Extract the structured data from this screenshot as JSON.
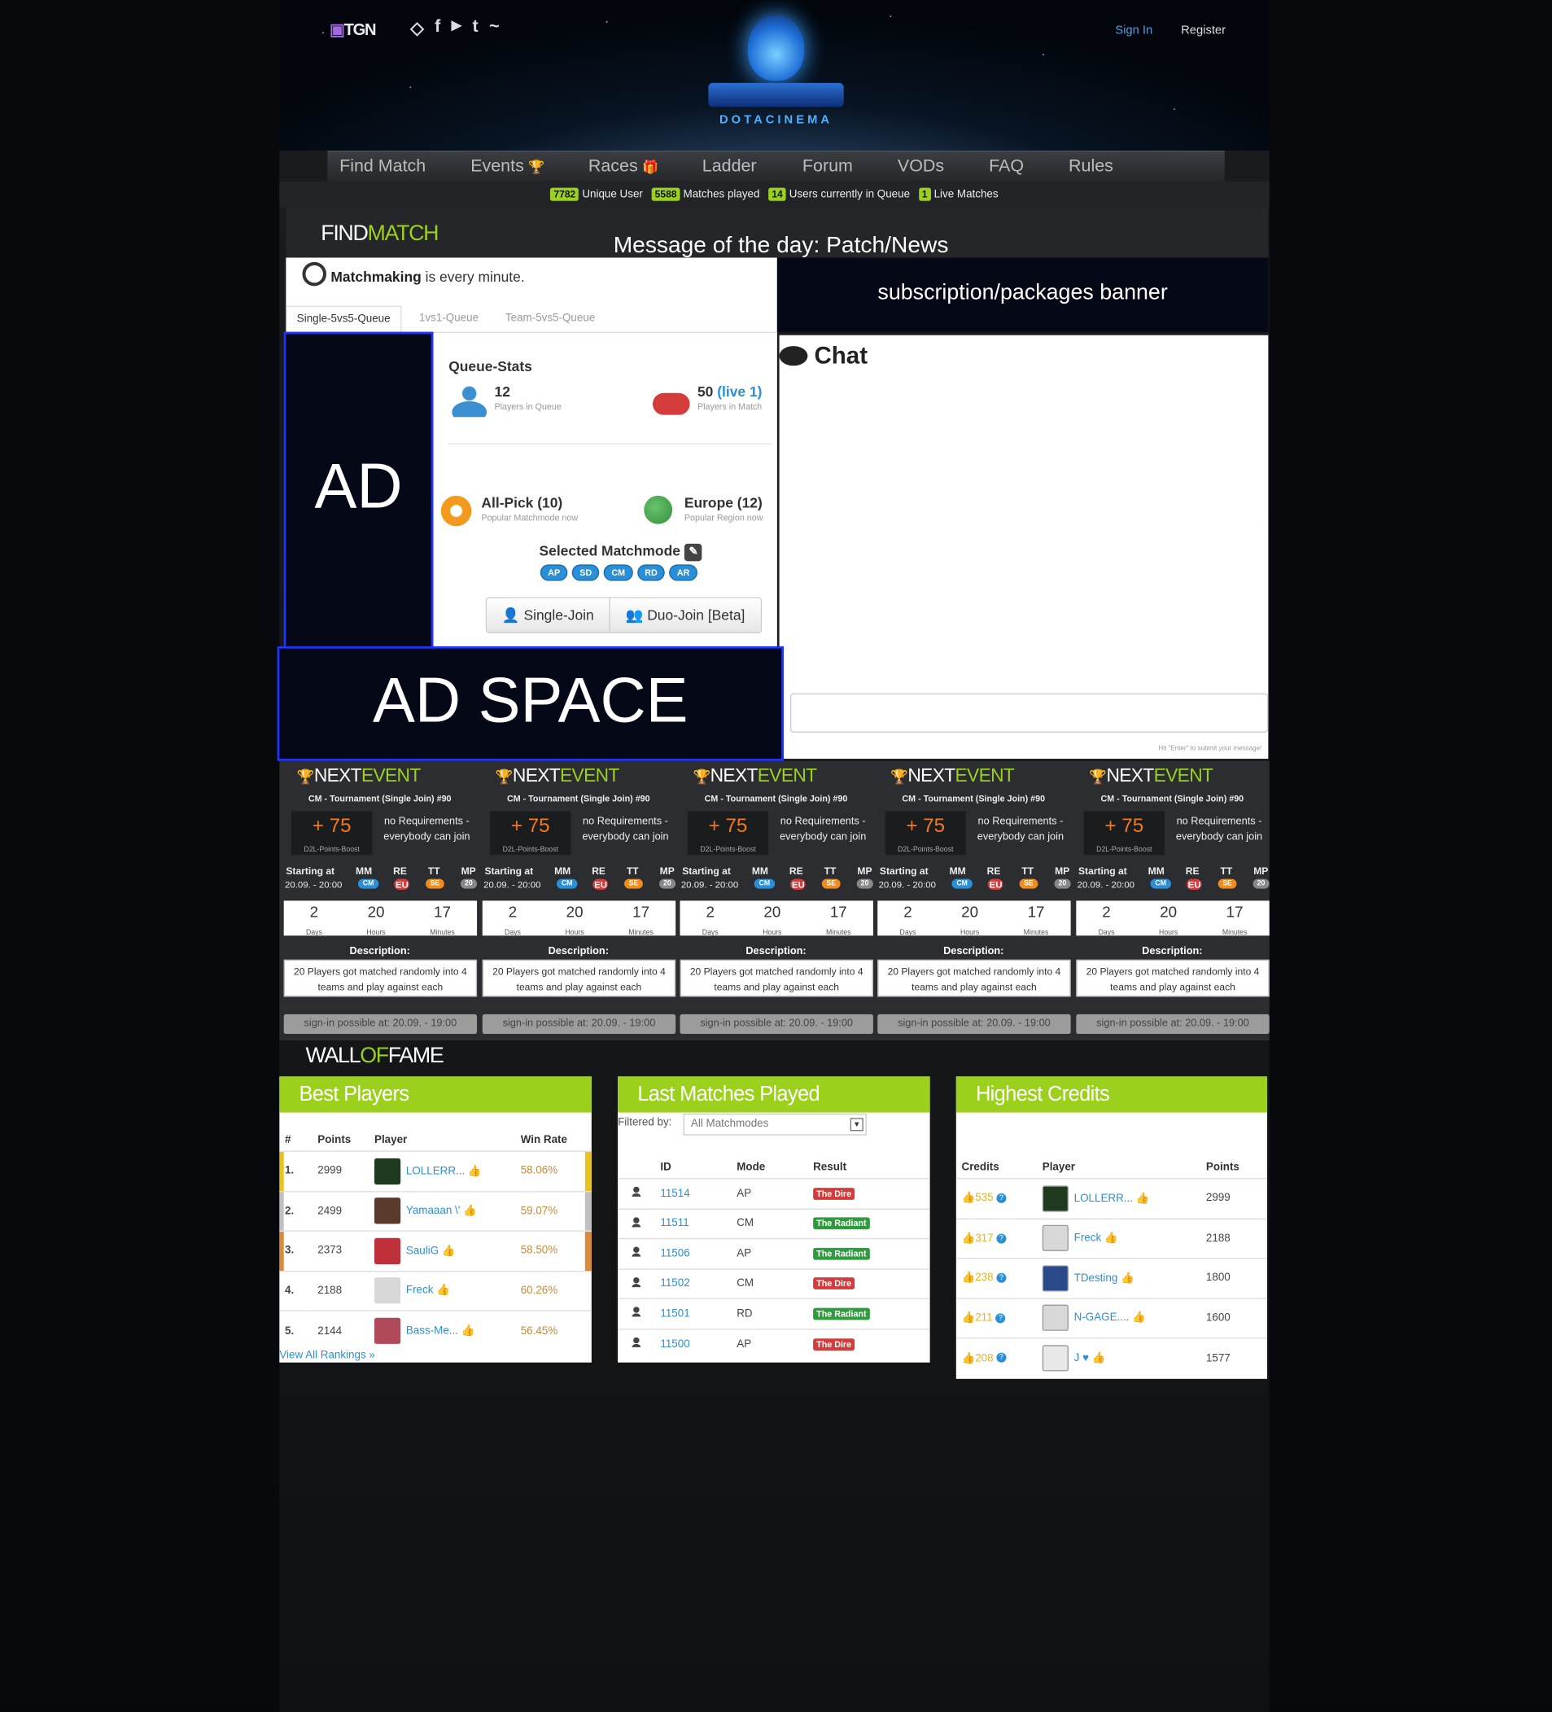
{
  "header": {
    "brand": "TGN",
    "social": [
      "steam-icon",
      "facebook-icon",
      "youtube-icon",
      "twitter-icon",
      "twitch-icon"
    ],
    "logo_text": "DOTACINEMA",
    "sign_in": "Sign In",
    "register": "Register"
  },
  "nav": [
    "Find Match",
    "Events",
    "Races",
    "Ladder",
    "Forum",
    "VODs",
    "FAQ",
    "Rules"
  ],
  "stats": [
    {
      "value": "7782",
      "label": "Unique User"
    },
    {
      "value": "5588",
      "label": "Matches played"
    },
    {
      "value": "14",
      "label": "Users currently in Queue"
    },
    {
      "value": "1",
      "label": "Live Matches"
    }
  ],
  "findmatch": {
    "title_a": "FIND",
    "title_b": "MATCH",
    "motd": "Message of the day: Patch/News"
  },
  "matchmaking": {
    "bold": "Matchmaking",
    "rest": " is every minute."
  },
  "tabs": [
    "Single-5vs5-Queue",
    "1vs1-Queue",
    "Team-5vs5-Queue"
  ],
  "banner": "subscription/packages banner",
  "chat": {
    "title": "Chat",
    "hint": "Hit \"Enter\" to submit your message!"
  },
  "ads": {
    "side": "AD",
    "bottom": "AD SPACE"
  },
  "queue": {
    "title": "Queue-Stats",
    "players_queue": "12",
    "players_queue_label": "Players in Queue",
    "players_match": "50",
    "players_match_live": "(live 1)",
    "players_match_label": "Players in Match",
    "mode": "All-Pick (10)",
    "mode_label": "Popular Matchmode now",
    "region": "Europe (12)",
    "region_label": "Popular Region now",
    "selected": "Selected Matchmode",
    "modes": [
      "AP",
      "SD",
      "CM",
      "RD",
      "AR"
    ],
    "single_join": "Single-Join",
    "duo_join": "Duo-Join [Beta]"
  },
  "event": {
    "title_a": "NEXT",
    "title_b": "EVENT",
    "name": "CM - Tournament (Single Join) #90",
    "points": "+ 75",
    "points_label": "D2L-Points-Boost",
    "req": "no Requirements - everybody can join",
    "h_start": "Starting at",
    "h_mm": "MM",
    "h_re": "RE",
    "h_tt": "TT",
    "h_mp": "MP",
    "start": "20.09. - 20:00",
    "mm": "CM",
    "re": "EU",
    "tt": "SE",
    "mp": "20",
    "days": "2",
    "days_l": "Days",
    "hours": "20",
    "hours_l": "Hours",
    "mins": "17",
    "mins_l": "Minutes",
    "desc_h": "Description:",
    "desc": "20 Players got matched randomly into 4 teams and play against each",
    "sign": "sign-in possible at: 20.09. - 19:00"
  },
  "wof": {
    "a": "WALL",
    "b": "OF",
    "c": "FAME"
  },
  "best": {
    "title": "Best Players",
    "cols": [
      "#",
      "Points",
      "Player",
      "Win Rate"
    ],
    "rows": [
      {
        "rank": "1.",
        "points": "2999",
        "player": "LOLLERR...",
        "rate": "58.06%",
        "color": "#1f3a1f",
        "bar": "#e8c21e"
      },
      {
        "rank": "2.",
        "points": "2499",
        "player": "Yamaaan \\'",
        "rate": "59.07%",
        "color": "#5a3a2a",
        "bar": "#c0c0c0"
      },
      {
        "rank": "3.",
        "points": "2373",
        "player": "SauliG",
        "rate": "58.50%",
        "color": "#c0303a",
        "bar": "#d98a3a"
      },
      {
        "rank": "4.",
        "points": "2188",
        "player": "Freck",
        "rate": "60.26%",
        "color": "#d8d8d8",
        "bar": ""
      },
      {
        "rank": "5.",
        "points": "2144",
        "player": "Bass-Me...",
        "rate": "56.45%",
        "color": "#b04a5a",
        "bar": ""
      }
    ],
    "view_all": "View All Rankings »"
  },
  "last": {
    "title": "Last Matches Played",
    "filter_label": "Filtered by:",
    "filter_value": "All Matchmodes",
    "cols": [
      "ID",
      "Mode",
      "Result"
    ],
    "rows": [
      {
        "id": "11514",
        "mode": "AP",
        "result": "The Dire",
        "dire": true
      },
      {
        "id": "11511",
        "mode": "CM",
        "result": "The Radiant",
        "dire": false
      },
      {
        "id": "11506",
        "mode": "AP",
        "result": "The Radiant",
        "dire": false
      },
      {
        "id": "11502",
        "mode": "CM",
        "result": "The Dire",
        "dire": true
      },
      {
        "id": "11501",
        "mode": "RD",
        "result": "The Radiant",
        "dire": false
      },
      {
        "id": "11500",
        "mode": "AP",
        "result": "The Dire",
        "dire": true
      }
    ]
  },
  "credits": {
    "title": "Highest Credits",
    "cols": [
      "Credits",
      "Player",
      "Points"
    ],
    "rows": [
      {
        "credits": "535",
        "player": "LOLLERR...",
        "points": "2999",
        "color": "#1f3a1f"
      },
      {
        "credits": "317",
        "player": "Freck",
        "points": "2188",
        "color": "#d8d8d8"
      },
      {
        "credits": "238",
        "player": "TDesting",
        "points": "1800",
        "color": "#2a4a8a"
      },
      {
        "credits": "211",
        "player": "N-GAGE....",
        "points": "1600",
        "color": "#d8d8d8"
      },
      {
        "credits": "208",
        "player": "J ♥",
        "points": "1577",
        "color": "#e8e8e8"
      }
    ]
  }
}
